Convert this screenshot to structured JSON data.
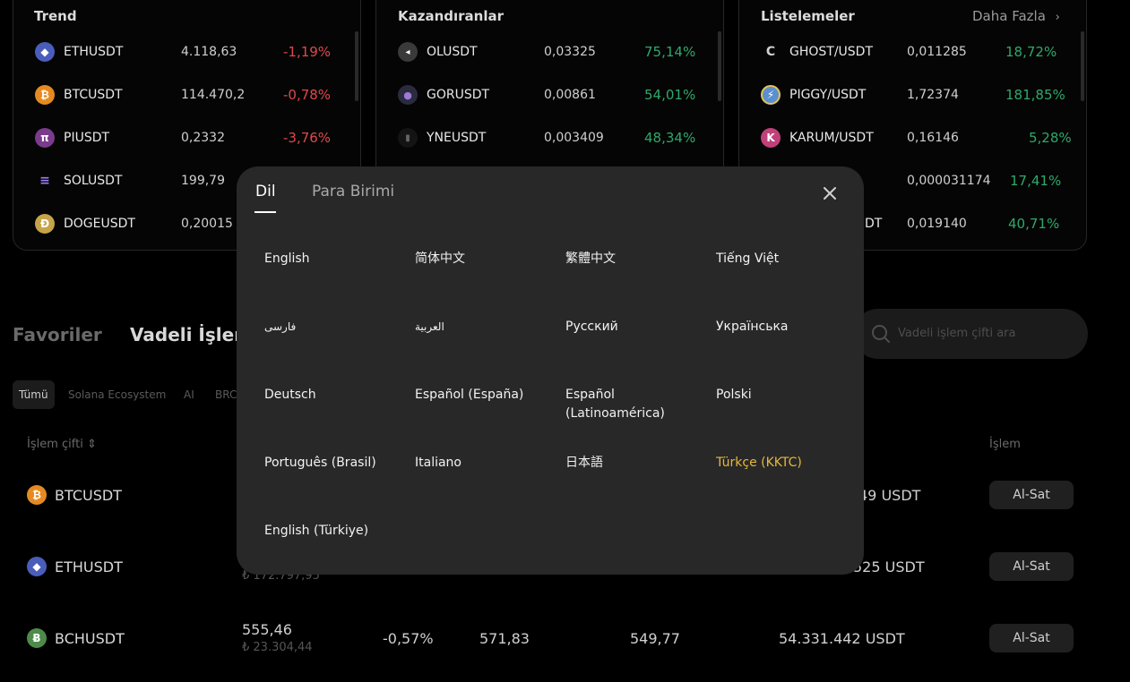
{
  "cards": {
    "trend": {
      "title": "Trend",
      "rows": [
        {
          "symbol": "ETHUSDT",
          "price": "4.118,63",
          "change": "-1,19%"
        },
        {
          "symbol": "BTCUSDT",
          "price": "114.470,2",
          "change": "-0,78%"
        },
        {
          "symbol": "PIUSDT",
          "price": "0,2332",
          "change": "-3,76%"
        },
        {
          "symbol": "SOLUSDT",
          "price": "199,79",
          "change": ""
        },
        {
          "symbol": "DOGEUSDT",
          "price": "0,20015",
          "change": ""
        }
      ]
    },
    "gainers": {
      "title": "Kazandıranlar",
      "rows": [
        {
          "symbol": "OLUSDT",
          "price": "0,03325",
          "change": "75,14%"
        },
        {
          "symbol": "GORUSDT",
          "price": "0,00861",
          "change": "54,01%"
        },
        {
          "symbol": "YNEUSDT",
          "price": "0,003409",
          "change": "48,34%"
        }
      ]
    },
    "listings": {
      "title": "Listelemeler",
      "more": "Daha Fazla",
      "rows": [
        {
          "symbol": "GHOST/USDT",
          "price": "0,011285",
          "change": "18,72%"
        },
        {
          "symbol": "PIGGY/USDT",
          "price": "1,72374",
          "change": "181,85%"
        },
        {
          "symbol": "KARUM/USDT",
          "price": "0,16146",
          "change": "5,28%"
        },
        {
          "symbol": "",
          "price": "0,000031174",
          "change": "17,41%"
        },
        {
          "symbol": "DT",
          "price": "0,019140",
          "change": "40,71%"
        }
      ]
    }
  },
  "section": {
    "tabs": [
      "Favoriler",
      "Vadeli İşleml"
    ],
    "search_placeholder": "Vadeli işlem çifti ara",
    "filters": [
      "Tümü",
      "Solana Ecosystem",
      "AI",
      "BRC"
    ]
  },
  "table": {
    "headers": {
      "pair": "İşlem çifti ⇕",
      "action": "İşlem"
    },
    "rows": [
      {
        "symbol": "BTCUSDT",
        "price": "",
        "price_try": "",
        "change": "",
        "high": "",
        "low": "",
        "volume": "49 USDT",
        "action": "Al-Sat"
      },
      {
        "symbol": "ETHUSDT",
        "price": "",
        "price_try": "₺ 172.797,95",
        "change": "",
        "high": "",
        "low": "",
        "volume": "525 USDT",
        "action": "Al-Sat"
      },
      {
        "symbol": "BCHUSDT",
        "price": "555,46",
        "price_try": "₺ 23.304,44",
        "change": "-0,57%",
        "high": "571,83",
        "low": "549,77",
        "volume": "54.331.442 USDT",
        "action": "Al-Sat"
      }
    ]
  },
  "modal": {
    "tabs": {
      "language": "Dil",
      "currency": "Para Birimi"
    },
    "languages": [
      "English",
      "简体中文",
      "繁體中文",
      "Tiếng Việt",
      "فارسی",
      "العربية",
      "Русский",
      "Українська",
      "Deutsch",
      "Español (España)",
      "Español (Latinoamérica)",
      "Polski",
      "Português (Brasil)",
      "Italiano",
      "日本語",
      "Türkçe (KKTC)",
      "English (Türkiye)"
    ],
    "selected_language": "Türkçe (KKTC)"
  },
  "colors": {
    "negative": "#e0484d",
    "positive": "#2fa86a",
    "selected": "#e6b73a",
    "modal_bg": "#282828"
  }
}
